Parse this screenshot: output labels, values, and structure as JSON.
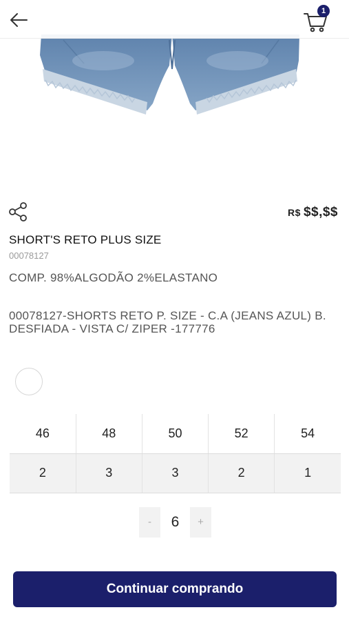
{
  "header": {
    "back_icon": "arrow-left-icon",
    "cart_icon": "shopping-cart-icon",
    "cart_count": "1"
  },
  "product": {
    "image": "denim-shorts-photo",
    "share_icon": "share-icon",
    "price_currency": "R$",
    "price_value": "$$,$$",
    "title": "SHORT'S RETO PLUS SIZE",
    "sku": "00078127",
    "composition": "COMP. 98%ALGODÃO 2%ELASTANO",
    "description": "00078127-SHORTS RETO P. SIZE - C.A (JEANS AZUL) B. DESFIADA - VISTA C/ ZIPER -177776"
  },
  "colors": {
    "selected_swatch": "#ffffff"
  },
  "size_grid": {
    "sizes": [
      "46",
      "48",
      "50",
      "52",
      "54"
    ],
    "quantities": [
      "2",
      "3",
      "3",
      "2",
      "1"
    ]
  },
  "quantity": {
    "minus_label": "-",
    "value": "6",
    "plus_label": "+"
  },
  "actions": {
    "continue_label": "Continuar comprando"
  },
  "theme": {
    "primary": "#1b1f6b",
    "denim": "#6e8fb3"
  }
}
